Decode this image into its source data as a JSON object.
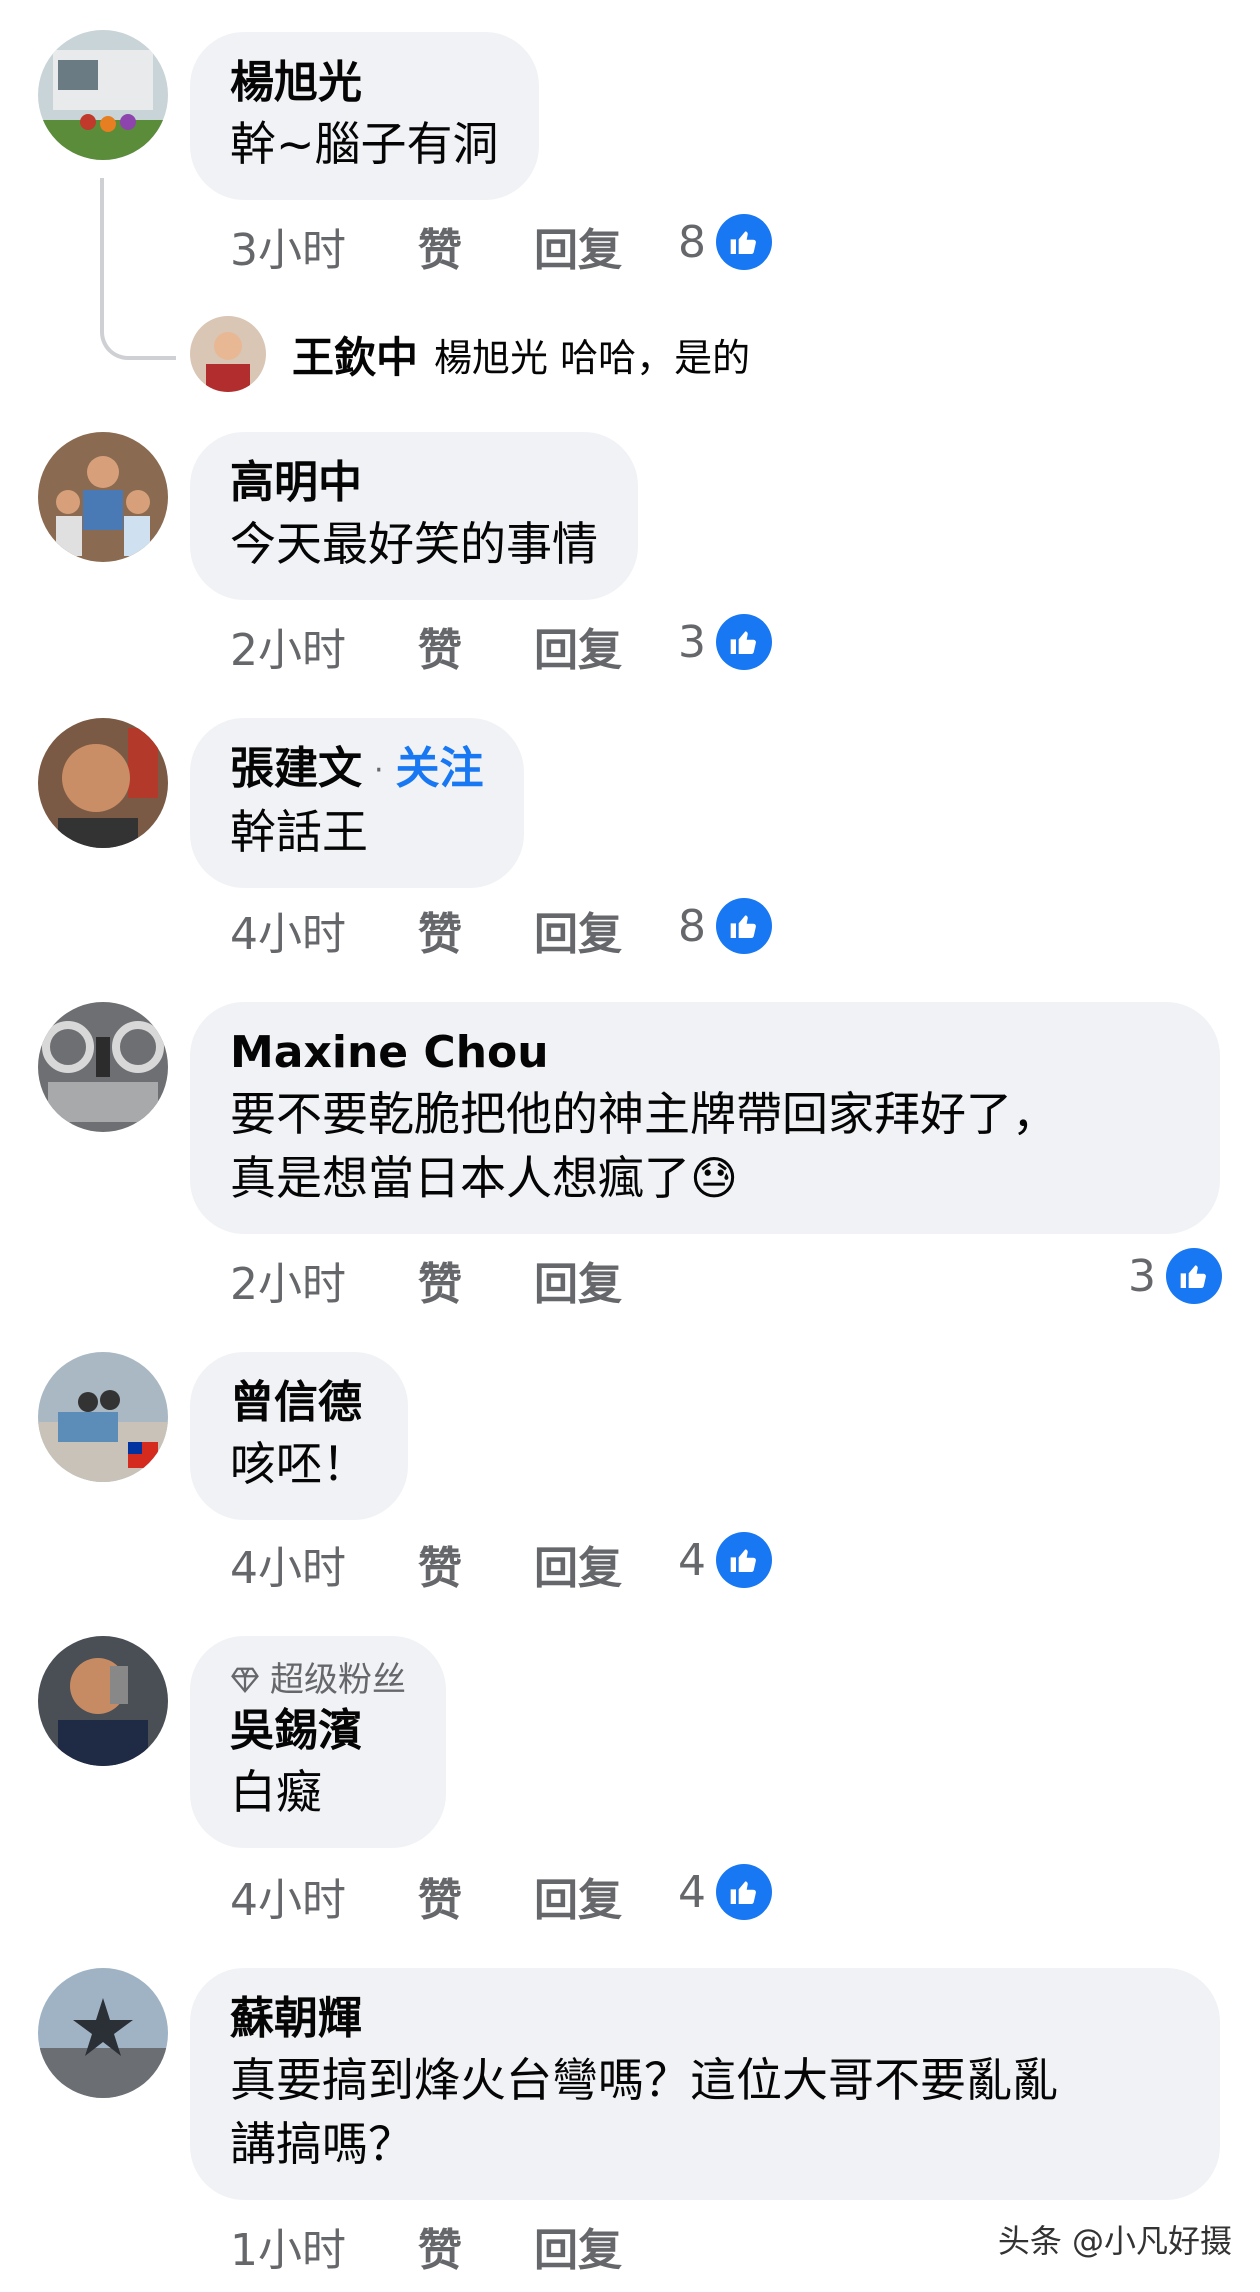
{
  "comments": [
    {
      "name": "楊旭光",
      "text": [
        "幹~腦子有洞"
      ],
      "time": "3小时",
      "like": "赞",
      "reply": "回复",
      "count": "8"
    },
    {
      "name": "高明中",
      "text": [
        "今天最好笑的事情"
      ],
      "time": "2小时",
      "like": "赞",
      "reply": "回复",
      "count": "3"
    },
    {
      "name": "張建文",
      "follow": "关注",
      "text": [
        "幹話王"
      ],
      "time": "4小时",
      "like": "赞",
      "reply": "回复",
      "count": "8"
    },
    {
      "name": "Maxine Chou",
      "text": [
        "要不要乾脆把他的神主牌帶回家拜好了，",
        "真是想當日本人想瘋了😓"
      ],
      "time": "2小时",
      "like": "赞",
      "reply": "回复",
      "count": "3"
    },
    {
      "name": "曾信德",
      "text": [
        "咳呸！"
      ],
      "time": "4小时",
      "like": "赞",
      "reply": "回复",
      "count": "4"
    },
    {
      "name": "吳錫濱",
      "badge": "超级粉丝",
      "text": [
        "白癡"
      ],
      "time": "4小时",
      "like": "赞",
      "reply": "回复",
      "count": "4"
    },
    {
      "name": "蘇朝輝",
      "text": [
        "真要搞到烽火台彎嗎？這位大哥不要亂亂",
        "講搞嗎？"
      ],
      "time": "1小时",
      "like": "赞",
      "reply": "回复",
      "count": ""
    }
  ],
  "reply": {
    "name": "王欽中",
    "text": "楊旭光 哈哈，是的"
  },
  "watermark": "头条 @小凡好摄",
  "colors": {
    "accent": "#1877f2",
    "bubble": "#f0f2f5",
    "meta": "#65676b"
  },
  "icons": {
    "like": "thumbs-up-icon",
    "badge": "diamond-icon"
  }
}
